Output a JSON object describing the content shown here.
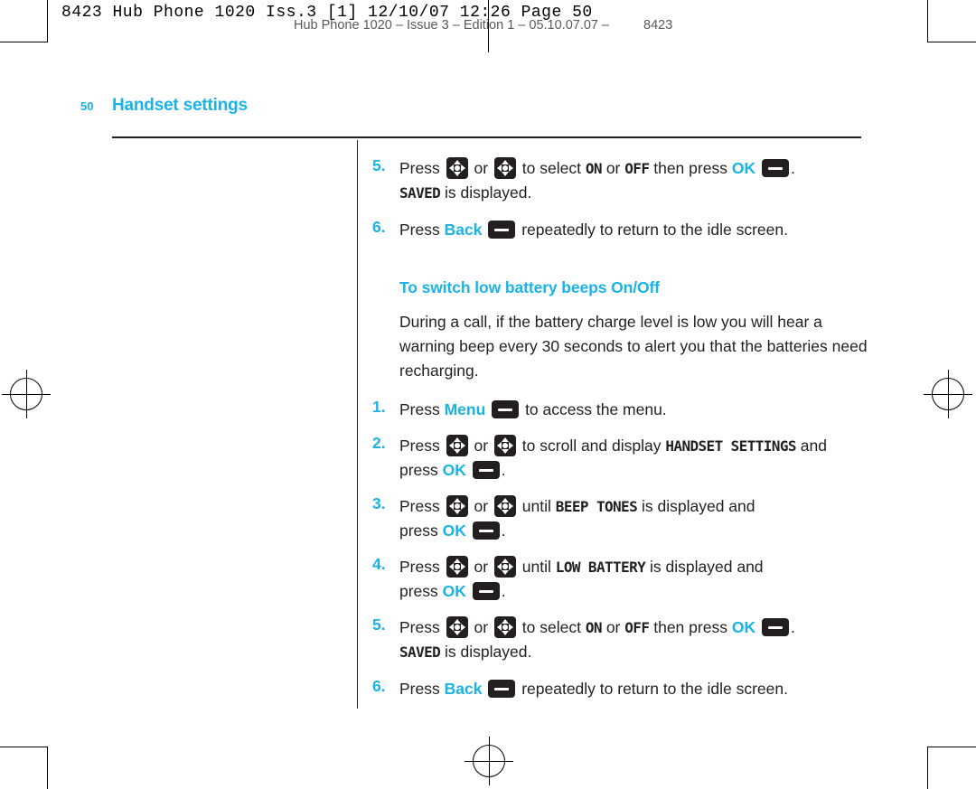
{
  "print_marks": {
    "header_line": "8423 Hub Phone 1020 Iss.3 [1]   12/10/07  12:26  Page 50",
    "running_head": "Hub Phone 1020 – Issue 3 – Edition 1 – 05.10.07.07 –",
    "running_head_right": "8423"
  },
  "page": {
    "folio": "50",
    "chapter_title": "Handset settings"
  },
  "icons": {
    "nav_key": "navigation-key-icon",
    "soft_key": "soft-key-icon"
  },
  "labels": {
    "press": "Press",
    "or": "or",
    "to_select": "to select",
    "then_press": "then press",
    "ok": "OK",
    "on": "ON",
    "off": "OFF",
    "back": "Back",
    "menu": "Menu",
    "saved": "SAVED",
    "is_displayed": "is displayed.",
    "repeatedly": "repeatedly to return to the idle screen.",
    "to_access_menu": "to access the menu.",
    "to_scroll_and_display": "to scroll and display",
    "handset_settings": "HANDSET SETTINGS",
    "and": "and",
    "press_lower": "press",
    "until": "until",
    "beep_tones": "BEEP TONES",
    "low_battery": "LOW BATTERY",
    "displayed_and": "is displayed and",
    "period": ".",
    "full_stop": "."
  },
  "top_steps": {
    "five_num": "5.",
    "six_num": "6."
  },
  "section": {
    "heading": "To switch low battery beeps On/Off",
    "intro": "During a call, if the battery charge level is low you will hear a warning beep every 30 seconds to alert you that the batteries need recharging.",
    "steps": [
      {
        "num": "1."
      },
      {
        "num": "2."
      },
      {
        "num": "3."
      },
      {
        "num": "4."
      },
      {
        "num": "5."
      },
      {
        "num": "6."
      }
    ]
  },
  "colors": {
    "accent": "#1ab3e8",
    "text": "#231f20"
  }
}
